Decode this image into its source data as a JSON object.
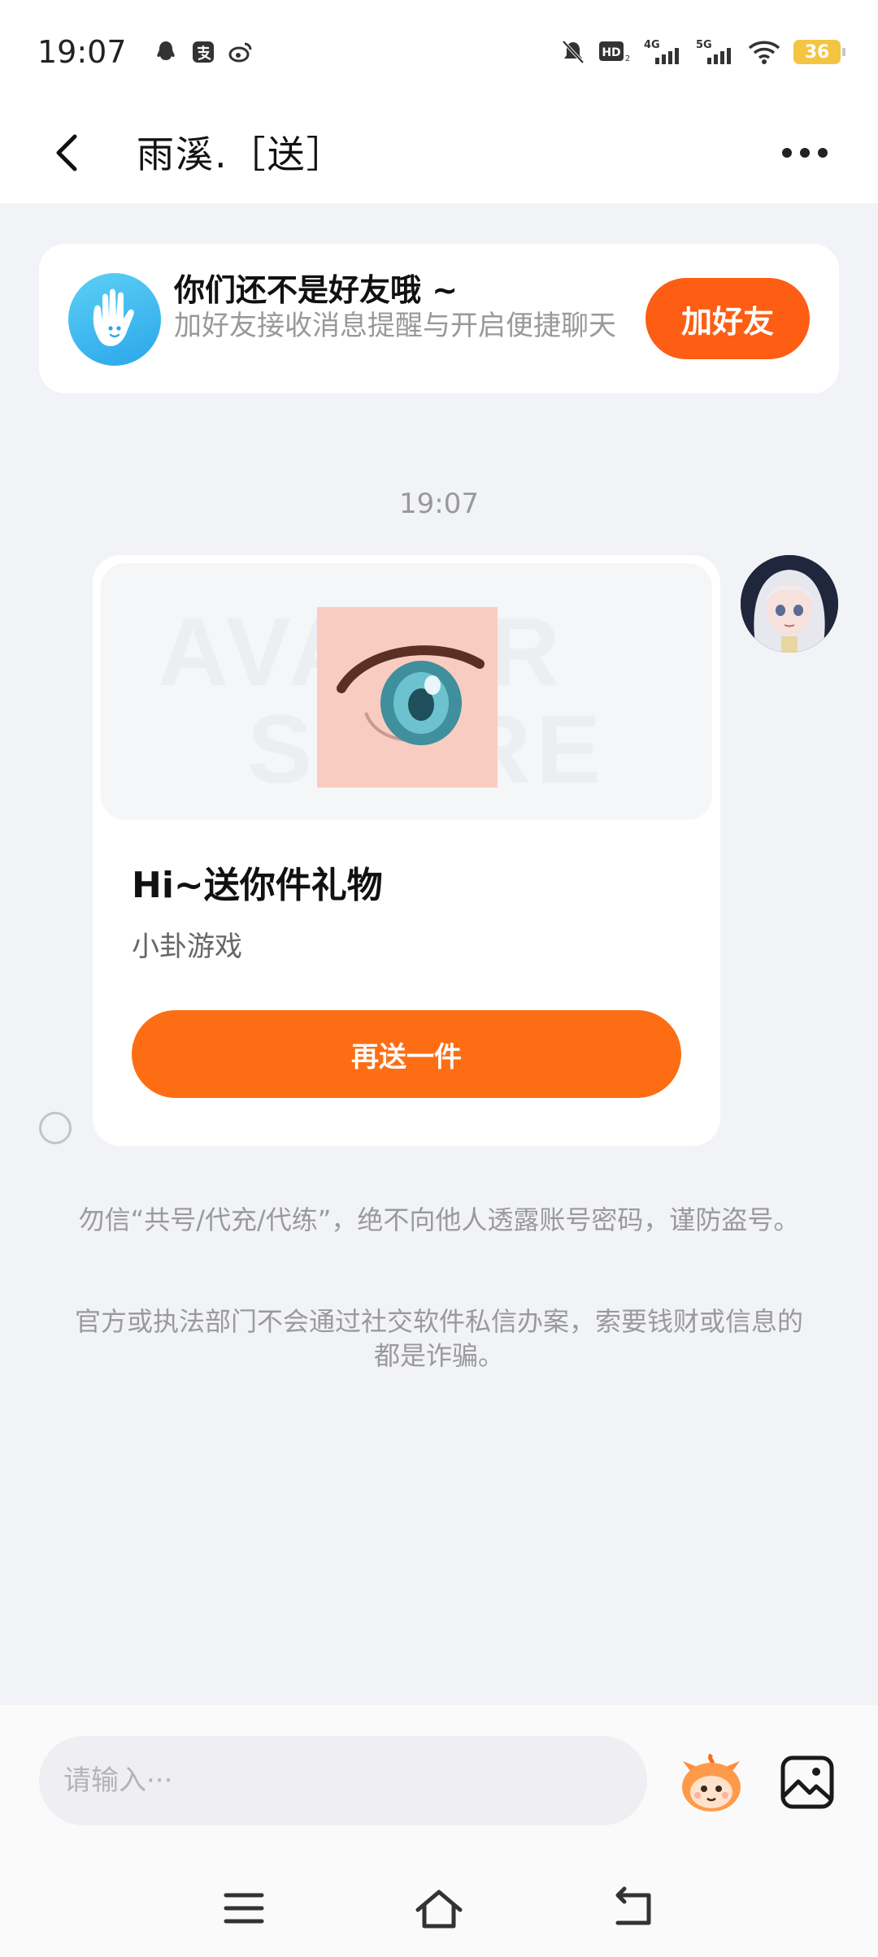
{
  "status_bar": {
    "time": "19:07",
    "apps": [
      "qq-icon",
      "alipay-icon",
      "weibo-icon"
    ],
    "signal_labels": [
      "HD",
      "4G",
      "5G"
    ],
    "battery": "36",
    "battery_color": "#f4c542"
  },
  "header": {
    "title": "雨溪.［送］",
    "back_icon": "chevron-left-icon",
    "more_icon": "more-dots-icon"
  },
  "friend_prompt": {
    "title": "你们还不是好友哦 ~",
    "subtitle": "加好友接收消息提醒与开启便捷聊天",
    "button_label": "加好友",
    "accent": "#fd5e13"
  },
  "chat": {
    "timestamp": "19:07",
    "gift_card": {
      "watermark_top": "AVATAR",
      "watermark_bottom": "STORE",
      "title": "Hi~送你件礼物",
      "subtitle": "小卦游戏",
      "button_label": "再送一件",
      "button_color": "#fd6e14"
    }
  },
  "notices": [
    "勿信“共号/代充/代练”，绝不向他人透露账号密码，谨防盗号。",
    "官方或执法部门不会通过社交软件私信办案，索要钱财或信息的都是诈骗。"
  ],
  "composer": {
    "placeholder": "请输入···",
    "value": ""
  }
}
